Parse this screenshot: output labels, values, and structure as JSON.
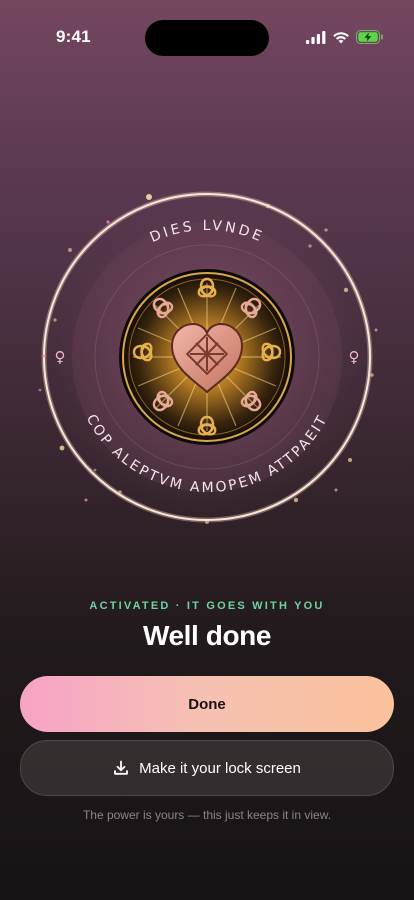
{
  "status_bar": {
    "time": "9:41",
    "icons": [
      "signal-icon",
      "wifi-icon",
      "battery-charging-icon"
    ]
  },
  "emblem": {
    "top_inscription": "DIES LVNDE",
    "bottom_inscription": "COP ALEPTVM AMOPEM ATTPAEIT",
    "side_symbol": "♀",
    "center_icon": "celtic-heart-knot-icon"
  },
  "main": {
    "status_label": "ACTIVATED · IT GOES WITH YOU",
    "title": "Well done",
    "done_button_label": "Done",
    "lock_screen_button_label": "Make it your lock screen",
    "footnote": "The power is yours — this just keeps it in view."
  },
  "colors": {
    "accent_green": "#6fd2a6",
    "done_gradient_start": "#f7a3c7",
    "done_gradient_end": "#fbc29b",
    "gold": "#d9a64a",
    "rose": "#e39a8e"
  }
}
